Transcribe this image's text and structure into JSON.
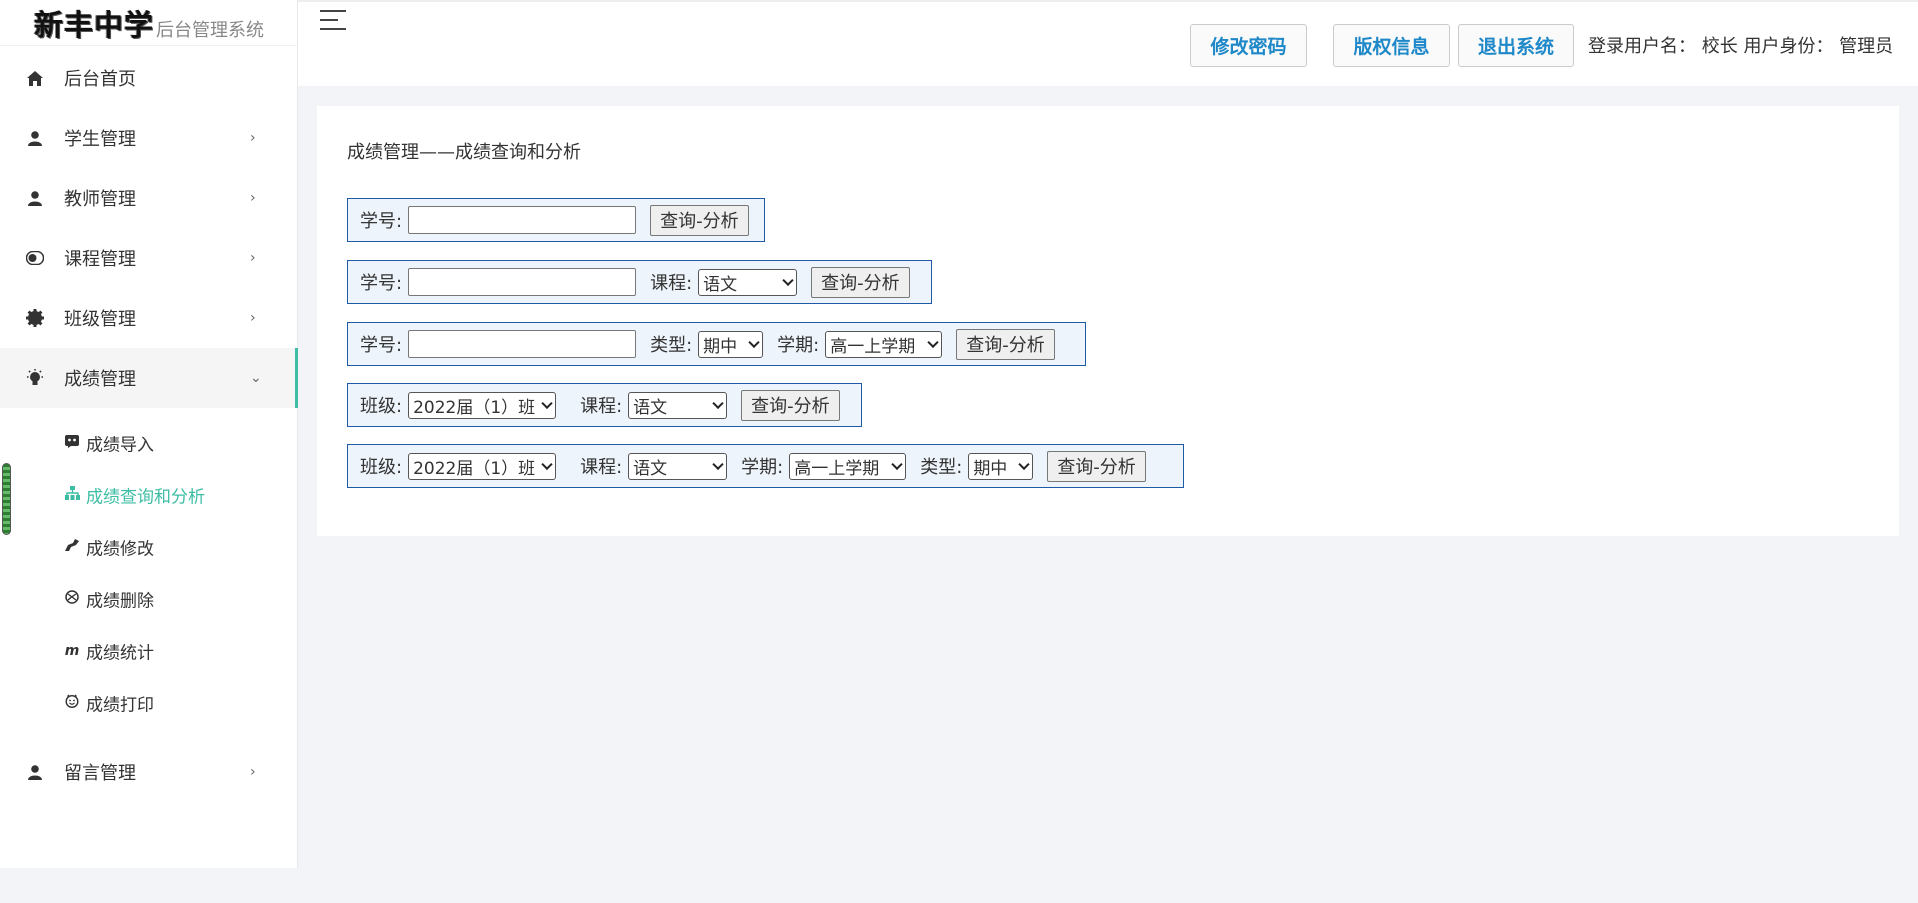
{
  "brand": {
    "school": "新丰中学",
    "system": "后台管理系统"
  },
  "sidebar": {
    "items": [
      {
        "label": "后台首页",
        "icon": "home-icon"
      },
      {
        "label": "学生管理",
        "icon": "person-icon",
        "arrow": "›"
      },
      {
        "label": "教师管理",
        "icon": "person-icon",
        "arrow": "›"
      },
      {
        "label": "课程管理",
        "icon": "toggle-icon",
        "arrow": "›"
      },
      {
        "label": "班级管理",
        "icon": "gear-icon",
        "arrow": "›"
      },
      {
        "label": "成绩管理",
        "icon": "bulb-icon",
        "arrow": "⌄"
      },
      {
        "label": "留言管理",
        "icon": "person-icon",
        "arrow": "›"
      }
    ],
    "sub_items": [
      {
        "label": "成绩导入",
        "icon": "import-icon"
      },
      {
        "label": "成绩查询和分析",
        "icon": "sitemap-icon"
      },
      {
        "label": "成绩修改",
        "icon": "edit-icon"
      },
      {
        "label": "成绩删除",
        "icon": "delete-icon"
      },
      {
        "label": "成绩统计",
        "icon": "stats-icon"
      },
      {
        "label": "成绩打印",
        "icon": "print-icon"
      }
    ]
  },
  "header": {
    "buttons": [
      "修改密码",
      "版权信息",
      "退出系统"
    ],
    "login_info": "登录用户名：  校长  用户身份：  管理员"
  },
  "main": {
    "title": "成绩管理——成绩查询和分析",
    "labels": {
      "student_id": "学号:",
      "course": "课程:",
      "type": "类型:",
      "term": "学期:",
      "class": "班级:"
    },
    "values": {
      "course": "语文",
      "type": "期中",
      "term": "高一上学期",
      "class": "2022届（1）班"
    },
    "query_button": "查询-分析"
  },
  "colors": {
    "accent": "#3dbea4",
    "header_button_text": "#1e88c8",
    "row_border": "#1f5aa6"
  }
}
